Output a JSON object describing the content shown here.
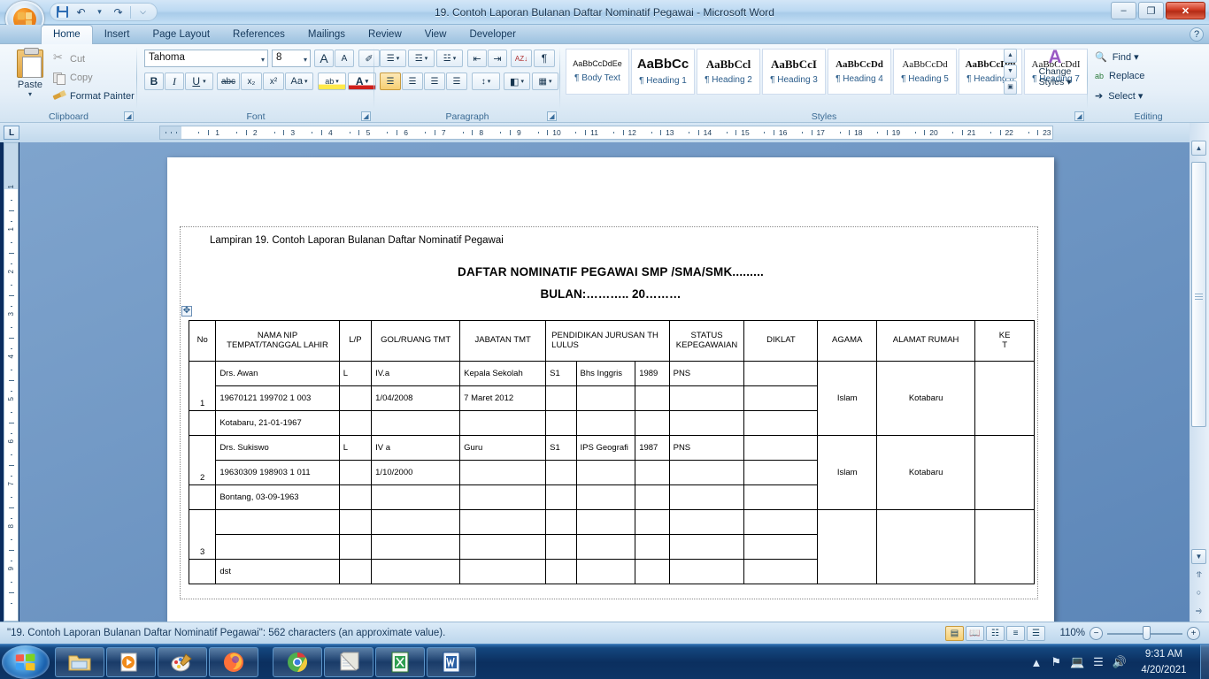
{
  "window": {
    "title": "19. Contoh Laporan Bulanan Daftar Nominatif Pegawai  -  Microsoft Word",
    "minimize": "–",
    "restore": "❐",
    "close": "✕"
  },
  "quick_access": {
    "save": "save-icon",
    "undo": "↶",
    "redo": "↷",
    "customize": "⌵"
  },
  "tabs": [
    {
      "label": "Home",
      "active": true
    },
    {
      "label": "Insert",
      "active": false
    },
    {
      "label": "Page Layout",
      "active": false
    },
    {
      "label": "References",
      "active": false
    },
    {
      "label": "Mailings",
      "active": false
    },
    {
      "label": "Review",
      "active": false
    },
    {
      "label": "View",
      "active": false
    },
    {
      "label": "Developer",
      "active": false
    }
  ],
  "help_icon": "?",
  "ribbon": {
    "clipboard": {
      "label": "Clipboard",
      "paste": "Paste",
      "paste_caret": "▾",
      "cut": "Cut",
      "copy": "Copy",
      "format_painter": "Format Painter"
    },
    "font": {
      "label": "Font",
      "font_name": "Tahoma",
      "font_size": "8",
      "grow_font": "A",
      "shrink_font": "A",
      "clear_formatting": "✐",
      "bold": "B",
      "italic": "I",
      "underline": "U",
      "strikethrough": "abc",
      "subscript": "x₂",
      "superscript": "x²",
      "change_case": "Aa",
      "highlight": "ab",
      "font_color": "A"
    },
    "paragraph": {
      "label": "Paragraph",
      "bullets": "☰",
      "numbering": "☲",
      "multilevel": "☳",
      "decrease_indent": "⇤",
      "increase_indent": "⇥",
      "sort": "AZ↓",
      "show_marks": "¶",
      "align_left": "☰",
      "align_center": "☰",
      "align_right": "☰",
      "justify": "☰",
      "line_spacing": "↕",
      "shading": "◧",
      "borders": "▦"
    },
    "styles": {
      "label": "Styles",
      "change_styles": "Change\nStyles",
      "change_styles_line1": "Change",
      "change_styles_line2": "Styles ▾",
      "items": [
        {
          "sample": "AaBbCcDdEe",
          "name": "¶ Body Text"
        },
        {
          "sample": "AaBbCс",
          "name": "¶ Heading 1"
        },
        {
          "sample": "AaBbCcl",
          "name": "¶ Heading 2"
        },
        {
          "sample": "AaBbCcI",
          "name": "¶ Heading 3"
        },
        {
          "sample": "AaBbCcDd",
          "name": "¶ Heading 4"
        },
        {
          "sample": "AaBbCcDd",
          "name": "¶ Heading 5"
        },
        {
          "sample": "AaBbCcDdl",
          "name": "¶ Heading 6"
        },
        {
          "sample": "AaBbCcDdI",
          "name": "¶ Heading 7"
        }
      ]
    },
    "editing": {
      "label": "Editing",
      "find": "Find ▾",
      "replace": "Replace",
      "select": "Select ▾"
    }
  },
  "ruler": {
    "tab_selector": "L",
    "h_marks": [
      "1",
      "2",
      "3",
      "4",
      "5",
      "6",
      "7",
      "8",
      "9",
      "10",
      "11",
      "12",
      "13",
      "14",
      "15",
      "16",
      "17",
      "18",
      "19",
      "20",
      "21",
      "22",
      "23"
    ],
    "v_marks": [
      "1",
      "1",
      "2",
      "3",
      "4",
      "5",
      "6",
      "7",
      "8",
      "9",
      "10"
    ]
  },
  "document": {
    "lampiran": "Lampiran 19. Contoh Laporan Bulanan Daftar Nominatif Pegawai",
    "title_line1": "DAFTAR NOMINATIF  PEGAWAI   SMP  /SMA/SMK.........",
    "title_line2": "BULAN:………..  20………",
    "table_handle": "✥",
    "table": {
      "headers": [
        "No",
        "NAMA NIP\nTEMPAT/TANGGAL LAHIR",
        "L/P",
        "GOL/RUANG TMT",
        "JABATAN TMT",
        "PENDIDIKAN JURUSAN TH LULUS",
        "STATUS KEPEGAWAIAN",
        "DIKLAT",
        "AGAMA",
        "ALAMAT RUMAH",
        "KE\nT"
      ],
      "header_nama_line1": "NAMA NIP",
      "header_nama_line2": "TEMPAT/TANGGAL LAHIR",
      "header_lp": "L/P",
      "header_no": "No",
      "header_gol": "GOL/RUANG TMT",
      "header_jabatan": "JABATAN TMT",
      "header_pendidikan": "PENDIDIKAN JURUSAN TH LULUS",
      "header_status_line1": "STATUS",
      "header_status_line2": "KEPEGAWAIAN",
      "header_diklat": "DIKLAT",
      "header_agama": "AGAMA",
      "header_alamat": "ALAMAT RUMAH",
      "header_ket_line1": "KE",
      "header_ket_line2": "T",
      "groups": [
        {
          "no": "1",
          "agama": "Islam",
          "alamat": "Kotabaru",
          "ket": "",
          "rows": [
            {
              "nama": "Drs. Awan",
              "lp": "L",
              "gol": "IV.a",
              "jabatan": "Kepala Sekolah",
              "jabatan_bold": true,
              "pend": "S1",
              "jurusan": "Bhs Inggris",
              "th": "1989",
              "status": "PNS",
              "diklat": ""
            },
            {
              "nama": "19670121 199702 1 003",
              "lp": "",
              "gol": "1/04/2008",
              "jabatan": "7 Maret 2012",
              "jabatan_bold": false,
              "pend": "",
              "jurusan": "",
              "th": "",
              "status": "",
              "diklat": ""
            },
            {
              "nama": "Kotabaru, 21-01-1967",
              "lp": "",
              "gol": "",
              "jabatan": "",
              "jabatan_bold": false,
              "pend": "",
              "jurusan": "",
              "th": "",
              "status": "",
              "diklat": ""
            }
          ]
        },
        {
          "no": "2",
          "agama": "Islam",
          "alamat": "Kotabaru",
          "ket": "",
          "rows": [
            {
              "nama": "Drs. Sukiswo",
              "lp": "L",
              "gol": "IV a",
              "jabatan": "Guru",
              "jabatan_bold": false,
              "pend": "S1",
              "jurusan": "IPS Geografi",
              "th": "1987",
              "status": "PNS",
              "diklat": ""
            },
            {
              "nama": "19630309 198903 1 011",
              "lp": "",
              "gol": "1/10/2000",
              "jabatan": "",
              "jabatan_bold": false,
              "pend": "",
              "jurusan": "",
              "th": "",
              "status": "",
              "diklat": ""
            },
            {
              "nama": "Bontang, 03-09-1963",
              "lp": "",
              "gol": "",
              "jabatan": "",
              "jabatan_bold": false,
              "pend": "",
              "jurusan": "",
              "th": "",
              "status": "",
              "diklat": ""
            }
          ]
        },
        {
          "no": "3",
          "agama": "",
          "alamat": "",
          "ket": "",
          "rows": [
            {
              "nama": "",
              "lp": "",
              "gol": "",
              "jabatan": "",
              "jabatan_bold": false,
              "pend": "",
              "jurusan": "",
              "th": "",
              "status": "",
              "diklat": ""
            },
            {
              "nama": "",
              "lp": "",
              "gol": "",
              "jabatan": "",
              "jabatan_bold": false,
              "pend": "",
              "jurusan": "",
              "th": "",
              "status": "",
              "diklat": ""
            },
            {
              "nama": "dst",
              "lp": "",
              "gol": "",
              "jabatan": "",
              "jabatan_bold": false,
              "pend": "",
              "jurusan": "",
              "th": "",
              "status": "",
              "diklat": ""
            }
          ]
        }
      ]
    }
  },
  "status_bar": {
    "text": "\"19. Contoh Laporan Bulanan Daftar Nominatif Pegawai\": 562 characters (an approximate value).",
    "zoom": "110%",
    "zoom_out": "−",
    "zoom_in": "+",
    "views": [
      "print-layout",
      "full-screen-reading",
      "web-layout",
      "outline",
      "draft"
    ]
  },
  "scrollbar": {
    "up": "▲",
    "down": "▼",
    "prev_page": "⥣",
    "select_object": "○",
    "next_page": "⥤",
    "select_browse_object": "▣"
  },
  "taskbar": {
    "start": "start-orb",
    "items": [
      "windows-explorer",
      "windows-media-player",
      "paint",
      "firefox",
      "google-chrome",
      "notepad",
      "microsoft-excel",
      "microsoft-word"
    ],
    "tray": {
      "show_hidden": "▲",
      "action_center": "flag-icon",
      "network": "network-icon",
      "signal": "signal-icon",
      "volume": "volume-icon"
    },
    "clock_time": "9:31 AM",
    "clock_date": "4/20/2021"
  }
}
